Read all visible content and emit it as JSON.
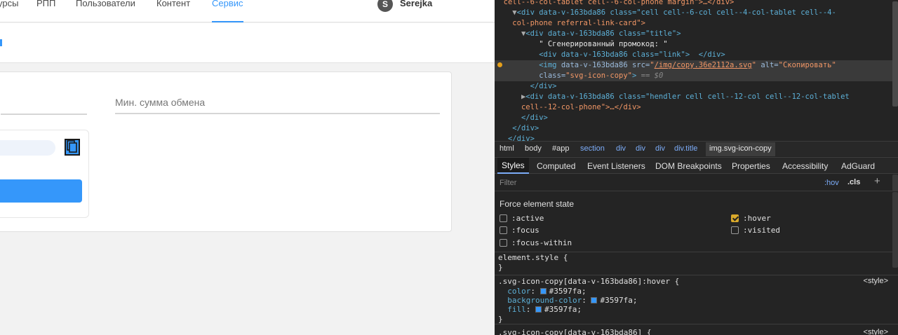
{
  "page": {
    "nav": {
      "items": [
        "урсы",
        "РПП",
        "Пользователи",
        "Контент",
        "Сервис"
      ],
      "active_index": 4,
      "user_initial": "S",
      "user_name": "Serejka"
    },
    "form": {
      "min_sum_label": "Мин. сумма обмена"
    }
  },
  "devtools": {
    "dom": [
      {
        "pre": "  cell--6-col-tablet cell--6-col-phone margin\">…</div>"
      },
      {
        "tag": "div data-v-163bda86 class=\"cell cell--6-col cell--4-col-tablet cell--4-"
      },
      {
        "cont": "col-phone referral-link-card\">"
      },
      {
        "tag": "div data-v-163bda86 class=\"title\">"
      },
      {
        "text": "\" Сгенерированный промокод: \""
      },
      {
        "tag": "<div data-v-163bda86 class=\"link\">  </div>"
      },
      {
        "img_src": "/img/copy.36e2112a.svg",
        "img_alt": "Скопировать",
        "img_class": "svg-icon-copy",
        "eq": "== $0"
      },
      {
        "close": "</div>"
      },
      {
        "tag": "div data-v-163bda86 class=\"hendler cell cell--12-col cell--12-col-tablet"
      },
      {
        "cont": "cell--12-col-phone\">…</div>"
      },
      {
        "close": "</div>"
      },
      {
        "close": "</div>"
      },
      {
        "close": "</div>"
      }
    ],
    "breadcrumbs": [
      "html",
      "body",
      "#app",
      "section",
      "div",
      "div",
      "div",
      "div.title",
      "img.svg-icon-copy"
    ],
    "tabs": [
      "Styles",
      "Computed",
      "Event Listeners",
      "DOM Breakpoints",
      "Properties",
      "Accessibility",
      "AdGuard"
    ],
    "active_tab": "Styles",
    "filter_placeholder": "Filter",
    "hov_label": ":hov",
    "cls_label": ".cls",
    "plus_label": "+",
    "force_state": {
      "title": "Force element state",
      "states": [
        {
          "name": ":active",
          "checked": false
        },
        {
          "name": ":focus",
          "checked": false
        },
        {
          "name": ":focus-within",
          "checked": false
        },
        {
          "name": ":hover",
          "checked": true
        },
        {
          "name": ":visited",
          "checked": false
        }
      ]
    },
    "element_style": {
      "open": "element.style {",
      "close": "}"
    },
    "hover_rule": {
      "selector": ".svg-icon-copy[data-v-163bda86]:hover {",
      "source": "<style>",
      "declarations": [
        {
          "prop": "color",
          "value": "#3597fa"
        },
        {
          "prop": "background-color",
          "value": "#3597fa"
        },
        {
          "prop": "fill",
          "value": "#3597fa"
        }
      ],
      "close": "}"
    },
    "next_rule": {
      "selector": ".svg-icon-copy[data-v-163bda86] {",
      "source": "<style>"
    },
    "accent": "#3597fa"
  }
}
